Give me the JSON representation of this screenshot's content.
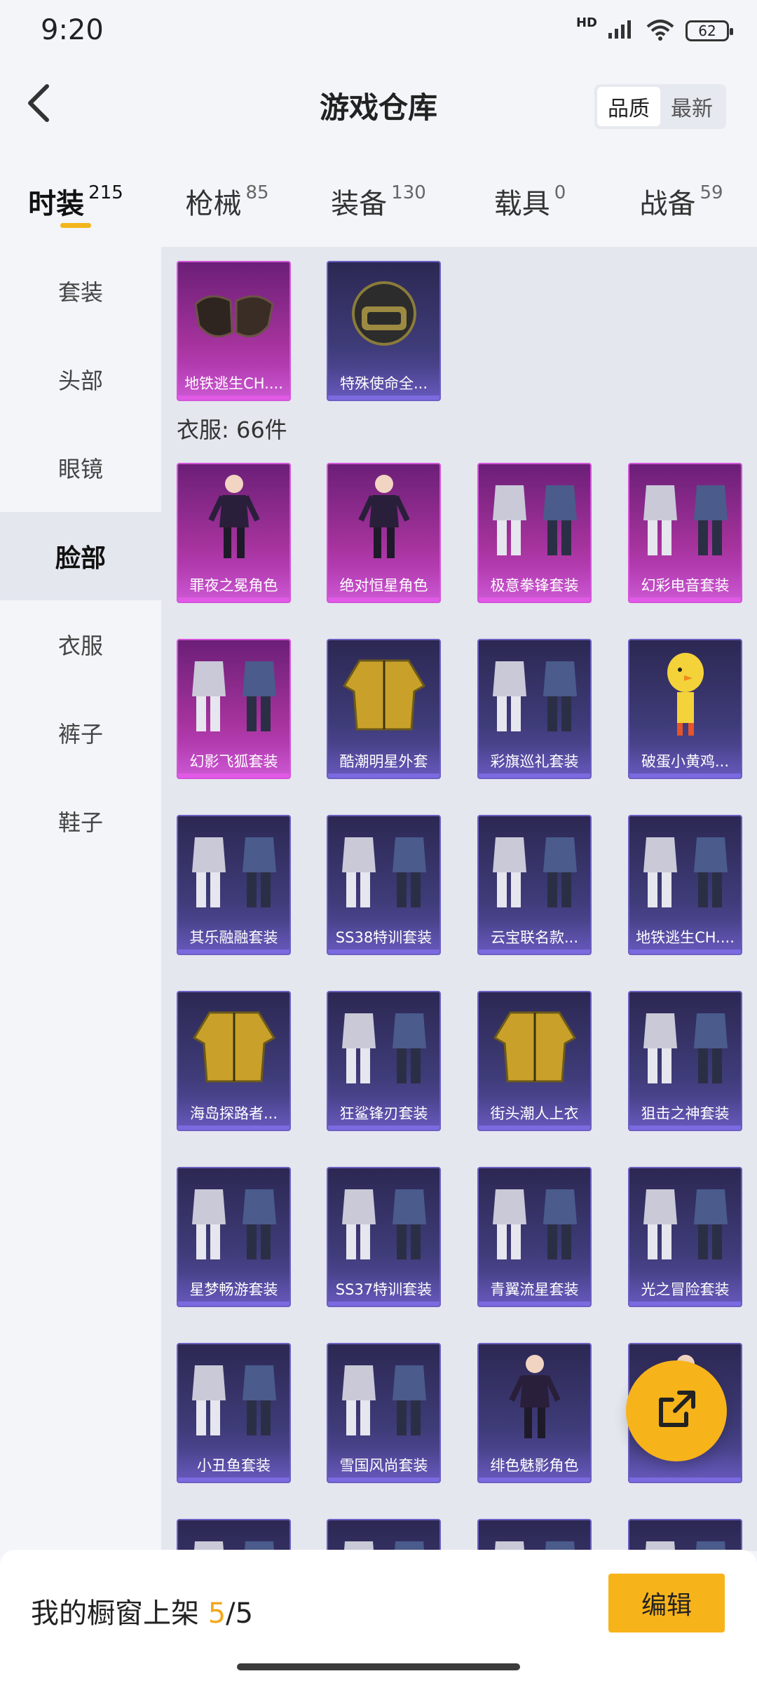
{
  "status_bar": {
    "time": "9:20",
    "network": "HD",
    "battery": "62"
  },
  "header": {
    "title": "游戏仓库",
    "sort_options": [
      "品质",
      "最新"
    ],
    "sort_active": 0
  },
  "categories": [
    {
      "label": "时装",
      "count": "215",
      "active": true
    },
    {
      "label": "枪械",
      "count": "85",
      "active": false
    },
    {
      "label": "装备",
      "count": "130",
      "active": false
    },
    {
      "label": "载具",
      "count": "0",
      "active": false
    },
    {
      "label": "战备",
      "count": "59",
      "active": false
    }
  ],
  "sidebar": {
    "items": [
      {
        "label": "套装"
      },
      {
        "label": "头部"
      },
      {
        "label": "眼镜"
      },
      {
        "label": "脸部",
        "active": true
      },
      {
        "label": "衣服"
      },
      {
        "label": "裤子"
      },
      {
        "label": "鞋子"
      }
    ]
  },
  "face_items": [
    {
      "name": "地铁逃生CH....",
      "rarity": "purple",
      "icon": "mask-icon"
    },
    {
      "name": "特殊使命全...",
      "rarity": "blue",
      "icon": "helmet-icon"
    }
  ],
  "clothes_section": {
    "label": "衣服: 66件"
  },
  "clothes_items": [
    {
      "name": "罪夜之冕角色",
      "rarity": "purple",
      "icon": "character-icon"
    },
    {
      "name": "绝对恒星角色",
      "rarity": "purple",
      "icon": "character-icon"
    },
    {
      "name": "极意拳锋套装",
      "rarity": "purple",
      "icon": "outfit-icon"
    },
    {
      "name": "幻彩电音套装",
      "rarity": "purple",
      "icon": "outfit-icon"
    },
    {
      "name": "幻影飞狐套装",
      "rarity": "purple",
      "icon": "outfit-icon"
    },
    {
      "name": "酷潮明星外套",
      "rarity": "blue",
      "icon": "jacket-icon"
    },
    {
      "name": "彩旗巡礼套装",
      "rarity": "blue",
      "icon": "outfit-icon"
    },
    {
      "name": "破蛋小黄鸡...",
      "rarity": "blue",
      "icon": "costume-icon"
    },
    {
      "name": "其乐融融套装",
      "rarity": "blue",
      "icon": "outfit-icon"
    },
    {
      "name": "SS38特训套装",
      "rarity": "blue",
      "icon": "outfit-icon"
    },
    {
      "name": "云宝联名款...",
      "rarity": "blue",
      "icon": "outfit-icon"
    },
    {
      "name": "地铁逃生CH....",
      "rarity": "blue",
      "icon": "outfit-icon"
    },
    {
      "name": "海岛探路者...",
      "rarity": "blue",
      "icon": "jacket-icon"
    },
    {
      "name": "狂鲨锋刃套装",
      "rarity": "blue",
      "icon": "outfit-icon"
    },
    {
      "name": "街头潮人上衣",
      "rarity": "blue",
      "icon": "jacket-icon"
    },
    {
      "name": "狙击之神套装",
      "rarity": "blue",
      "icon": "outfit-icon"
    },
    {
      "name": "星梦畅游套装",
      "rarity": "blue",
      "icon": "outfit-icon"
    },
    {
      "name": "SS37特训套装",
      "rarity": "blue",
      "icon": "outfit-icon"
    },
    {
      "name": "青翼流星套装",
      "rarity": "blue",
      "icon": "outfit-icon"
    },
    {
      "name": "光之冒险套装",
      "rarity": "blue",
      "icon": "outfit-icon"
    },
    {
      "name": "小丑鱼套装",
      "rarity": "blue",
      "icon": "outfit-icon"
    },
    {
      "name": "雪国风尚套装",
      "rarity": "blue",
      "icon": "outfit-icon"
    },
    {
      "name": "绯色魅影角色",
      "rarity": "blue",
      "icon": "character-icon"
    },
    {
      "name": "",
      "rarity": "blue",
      "icon": "character-icon"
    }
  ],
  "bottom_bar": {
    "showcase_label": "我的橱窗上架",
    "showcase_used": "5",
    "showcase_sep": "/",
    "showcase_total": "5",
    "edit_label": "编辑"
  },
  "colors": {
    "accent": "#f7b31a",
    "rare_purple": "#a6339d",
    "rare_blue": "#3e3b78",
    "background": "#f3f5f9"
  }
}
